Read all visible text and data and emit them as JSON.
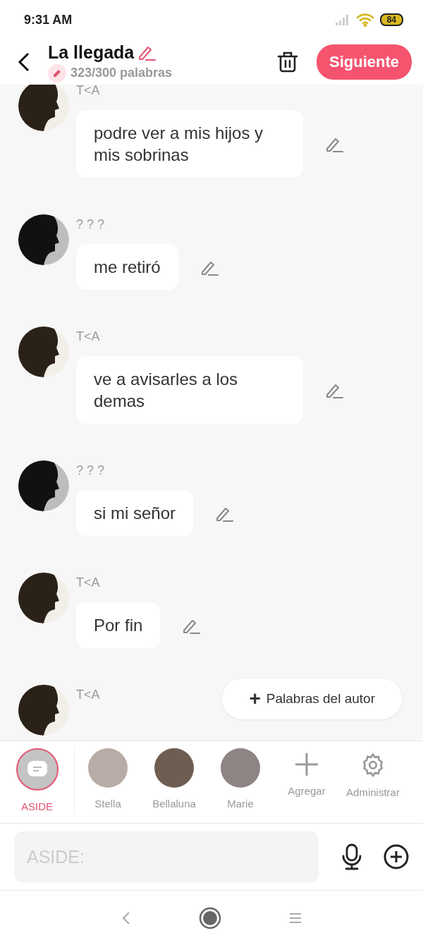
{
  "status_bar": {
    "time": "9:31 AM",
    "battery": "84"
  },
  "header": {
    "title": "La llegada",
    "word_count": "323/300 palabras",
    "next_button": "Siguiente"
  },
  "messages": [
    {
      "name": "T<A",
      "kind": "dark",
      "text": "podre ver a mis hijos y mis sobrinas"
    },
    {
      "name": "? ? ?",
      "kind": "grey",
      "text": "me retiró"
    },
    {
      "name": "T<A",
      "kind": "dark",
      "text": "ve a avisarles a los demas"
    },
    {
      "name": "? ? ?",
      "kind": "grey",
      "text": "si mi señor"
    },
    {
      "name": "T<A",
      "kind": "dark",
      "text": "Por fin"
    },
    {
      "name": "T<A",
      "kind": "dark"
    }
  ],
  "author_words_button": {
    "icon": "+",
    "label": "Palabras del autor"
  },
  "characters": [
    {
      "kind": "aside",
      "label": "ASIDE",
      "selected": true
    },
    {
      "kind": "character",
      "label": "Stella",
      "selected": false
    },
    {
      "kind": "character",
      "label": "Bellaluna",
      "selected": false
    },
    {
      "kind": "character",
      "label": "Marie",
      "selected": false
    },
    {
      "kind": "add",
      "label": "Agregar"
    },
    {
      "kind": "manage",
      "label": "Administrar"
    }
  ],
  "composer": {
    "placeholder": "ASIDE:"
  }
}
